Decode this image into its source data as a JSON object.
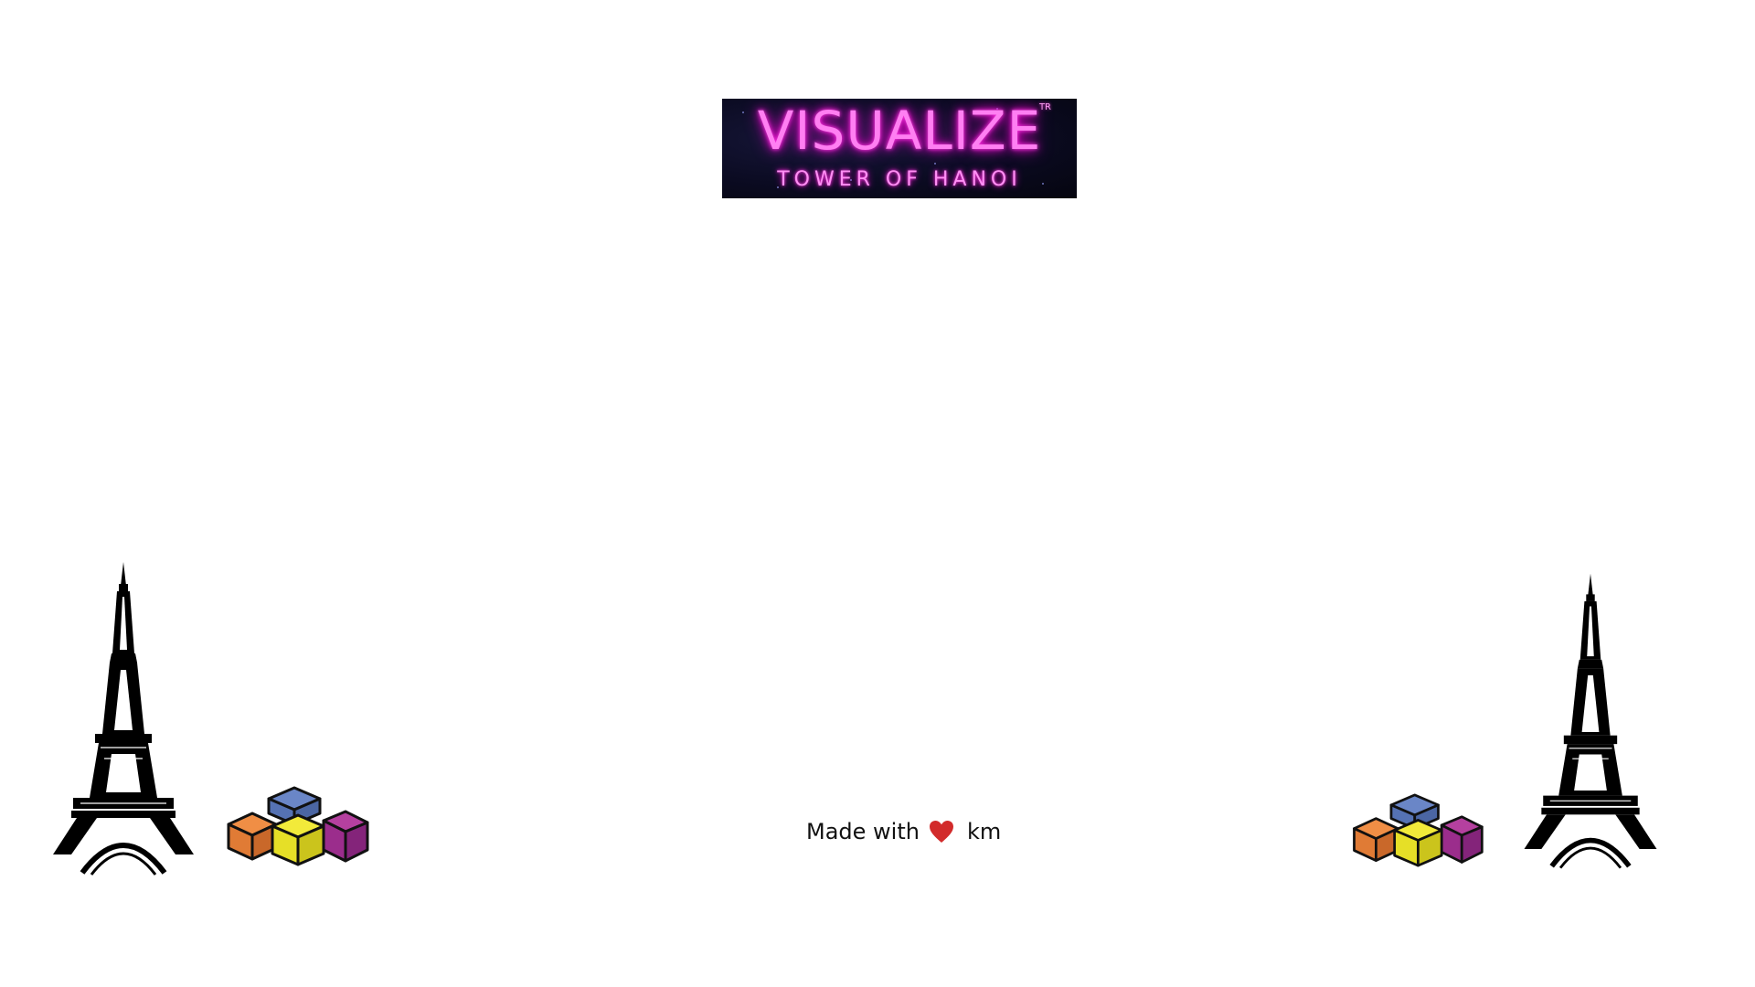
{
  "logo": {
    "title": "VISUALIZE",
    "subtitle": "TOWER OF HANOI",
    "trademark": "TR"
  },
  "footer": {
    "made_with": "Made with",
    "heart_icon": "heart-icon",
    "author": "km"
  },
  "decorations": {
    "left_tower_icon": "eiffel-tower-icon",
    "left_blocks_icon": "stacked-blocks-icon",
    "right_blocks_icon": "stacked-blocks-icon",
    "right_tower_icon": "eiffel-tower-icon"
  },
  "colors": {
    "neon_pink": "#ff7ff2",
    "banner_bg": "#0b0b22",
    "heart": "#d22b2b",
    "block_orange": "#e07b35",
    "block_blue": "#6a86c7",
    "block_yellow": "#e6df27",
    "block_purple": "#9b2d8c"
  }
}
